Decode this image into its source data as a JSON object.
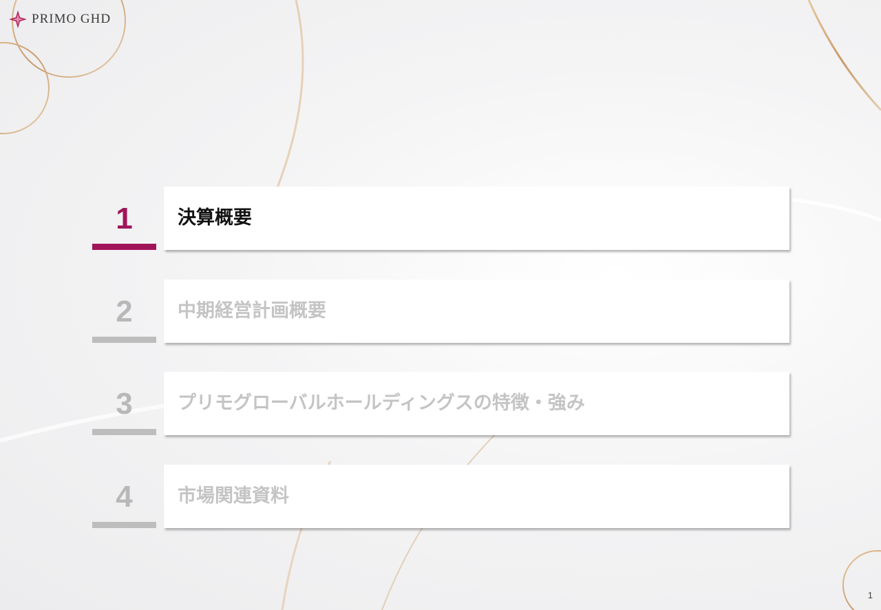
{
  "header": {
    "logo_text": "PRIMO GHD",
    "logo_icon": "diamond-star-icon",
    "accent_color": "#a0155a"
  },
  "toc": {
    "items": [
      {
        "number": "1",
        "label": "決算概要",
        "active": true
      },
      {
        "number": "2",
        "label": "中期経営計画概要",
        "active": false
      },
      {
        "number": "3",
        "label": "プリモグローバルホールディングスの特徴・強み",
        "active": false
      },
      {
        "number": "4",
        "label": "市場関連資料",
        "active": false
      }
    ],
    "inactive_color": "#bdbdbd"
  },
  "footer": {
    "page_number": "1"
  }
}
